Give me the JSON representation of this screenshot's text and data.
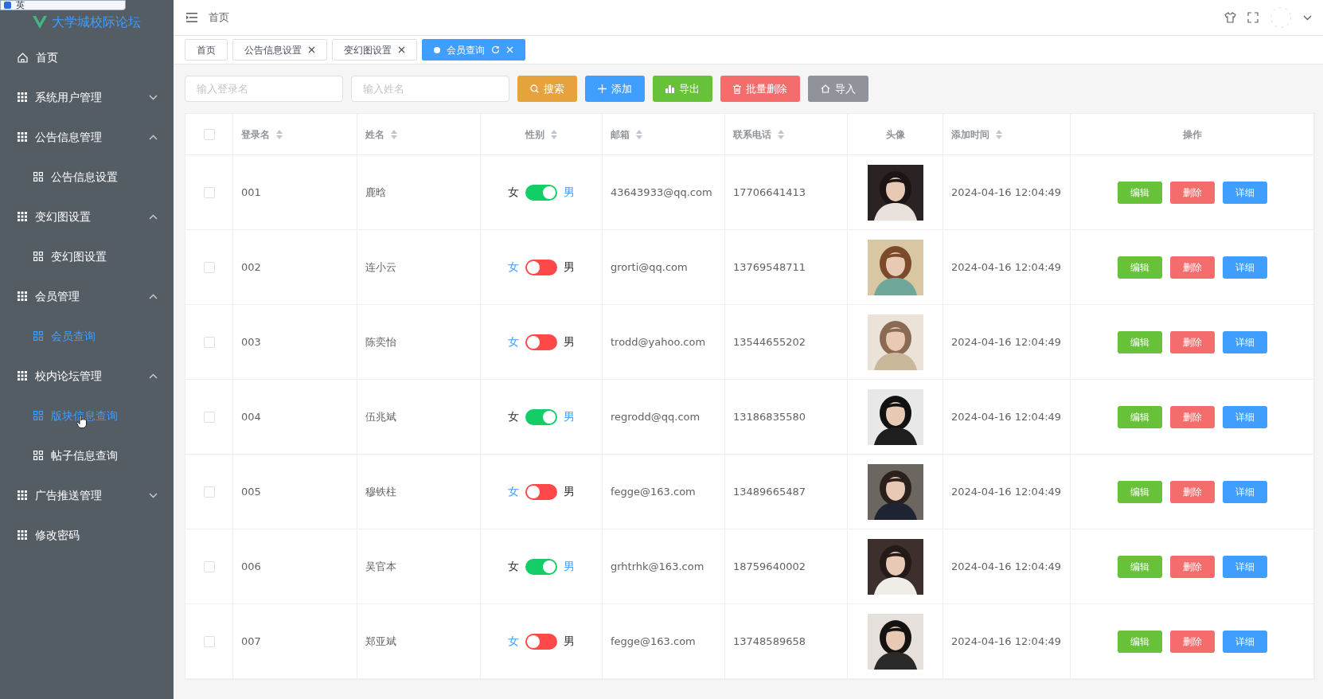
{
  "ime_bar": {
    "label": "英"
  },
  "logo": {
    "text": "大学城校际论坛"
  },
  "sidebar": {
    "items": [
      {
        "label": "首页",
        "kind": "home"
      },
      {
        "label": "系统用户管理",
        "kind": "group",
        "expanded": false
      },
      {
        "label": "公告信息管理",
        "kind": "group",
        "expanded": true,
        "children": [
          {
            "label": "公告信息设置",
            "selected": false,
            "hovered": false
          }
        ]
      },
      {
        "label": "变幻图设置",
        "kind": "group",
        "expanded": true,
        "children": [
          {
            "label": "变幻图设置",
            "selected": false,
            "hovered": false
          }
        ]
      },
      {
        "label": "会员管理",
        "kind": "group",
        "expanded": true,
        "children": [
          {
            "label": "会员查询",
            "selected": true,
            "hovered": false
          }
        ]
      },
      {
        "label": "校内论坛管理",
        "kind": "group",
        "expanded": true,
        "children": [
          {
            "label": "版块信息查询",
            "selected": false,
            "hovered": true
          },
          {
            "label": "帖子信息查询",
            "selected": false,
            "hovered": false
          }
        ]
      },
      {
        "label": "广告推送管理",
        "kind": "group",
        "expanded": false
      },
      {
        "label": "修改密码",
        "kind": "link"
      }
    ]
  },
  "breadcrumb": "首页",
  "tabs": [
    {
      "label": "首页",
      "selected": false,
      "closable": false
    },
    {
      "label": "公告信息设置",
      "selected": false,
      "closable": true
    },
    {
      "label": "变幻图设置",
      "selected": false,
      "closable": true
    },
    {
      "label": "会员查询",
      "selected": true,
      "closable": true
    }
  ],
  "search": [
    {
      "placeholder": "输入登录名"
    },
    {
      "placeholder": "输入姓名"
    }
  ],
  "buttons": [
    {
      "label": "搜索",
      "kind": "search"
    },
    {
      "label": "添加",
      "kind": "add"
    },
    {
      "label": "导出",
      "kind": "export"
    },
    {
      "label": "批量删除",
      "kind": "delete"
    },
    {
      "label": "导入",
      "kind": "import"
    }
  ],
  "table": {
    "columns": [
      {
        "label": "登录名",
        "sortable": true
      },
      {
        "label": "姓名",
        "sortable": true
      },
      {
        "label": "性别",
        "sortable": true
      },
      {
        "label": "邮箱",
        "sortable": true
      },
      {
        "label": "联系电话",
        "sortable": true
      },
      {
        "label": "头像",
        "sortable": false
      },
      {
        "label": "添加时间",
        "sortable": true
      },
      {
        "label": "操作",
        "sortable": false
      }
    ],
    "all_checked": false,
    "rows": [
      {
        "checked": false,
        "login": "001",
        "name": "鹿晗",
        "male": true,
        "email": "43643933@qq.com",
        "phone": "17706641413",
        "avatar": {
          "kind": "picture"
        },
        "added": "2024-04-16 12:04:49",
        "female_label": "女",
        "male_label": "男",
        "actions": [
          "编辑",
          "删除",
          "详细"
        ]
      },
      {
        "checked": false,
        "login": "002",
        "name": "连小云",
        "male": false,
        "email": "grorti@qq.com",
        "phone": "13769548711",
        "avatar": {
          "kind": "picture"
        },
        "added": "2024-04-16 12:04:49",
        "female_label": "女",
        "male_label": "男",
        "actions": [
          "编辑",
          "删除",
          "详细"
        ]
      },
      {
        "checked": false,
        "login": "003",
        "name": "陈奕怡",
        "male": false,
        "email": "trodd@yahoo.com",
        "phone": "13544655202",
        "avatar": {
          "kind": "picture"
        },
        "added": "2024-04-16 12:04:49",
        "female_label": "女",
        "male_label": "男",
        "actions": [
          "编辑",
          "删除",
          "详细"
        ]
      },
      {
        "checked": false,
        "login": "004",
        "name": "伍兆斌",
        "male": true,
        "email": "regrodd@qq.com",
        "phone": "13186835580",
        "avatar": {
          "kind": "picture"
        },
        "added": "2024-04-16 12:04:49",
        "female_label": "女",
        "male_label": "男",
        "actions": [
          "编辑",
          "删除",
          "详细"
        ]
      },
      {
        "checked": false,
        "login": "005",
        "name": "穆铁柱",
        "male": false,
        "email": "fegge@163.com",
        "phone": "13489665487",
        "avatar": {
          "kind": "picture"
        },
        "added": "2024-04-16 12:04:49",
        "female_label": "女",
        "male_label": "男",
        "actions": [
          "编辑",
          "删除",
          "详细"
        ]
      },
      {
        "checked": false,
        "login": "006",
        "name": "吴官本",
        "male": true,
        "email": "grhtrhk@163.com",
        "phone": "18759640002",
        "avatar": {
          "kind": "picture"
        },
        "added": "2024-04-16 12:04:49",
        "female_label": "女",
        "male_label": "男",
        "actions": [
          "编辑",
          "删除",
          "详细"
        ]
      },
      {
        "checked": false,
        "login": "007",
        "name": "郑亚斌",
        "male": false,
        "email": "fegge@163.com",
        "phone": "13748589658",
        "avatar": {
          "kind": "picture"
        },
        "added": "2024-04-16 12:04:49",
        "female_label": "女",
        "male_label": "男",
        "actions": [
          "编辑",
          "删除",
          "详细"
        ]
      }
    ]
  }
}
